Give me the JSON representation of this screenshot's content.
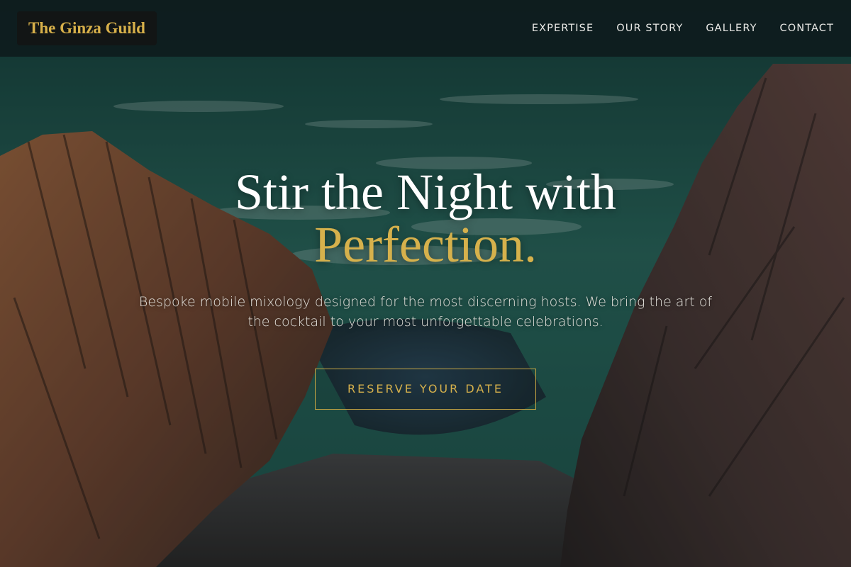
{
  "brand": {
    "name": "The Ginza Guild",
    "color": "#d6b14c"
  },
  "nav": {
    "items": [
      {
        "label": "EXPERTISE"
      },
      {
        "label": "OUR STORY"
      },
      {
        "label": "GALLERY"
      },
      {
        "label": "CONTACT"
      }
    ]
  },
  "hero": {
    "headline_line1": "Stir the Night with",
    "headline_line2": "Perfection.",
    "subtitle": "Bespoke mobile mixology designed for the most discerning hosts. We bring the art of the cocktail to your most unforgettable celebrations.",
    "cta_label": "RESERVE YOUR DATE",
    "background_image": "coastal-rocks-ocean-photo"
  },
  "colors": {
    "accent_gold": "#d6b14c",
    "nav_background": "#0e1a1c",
    "text_light": "#e9e9e6"
  }
}
